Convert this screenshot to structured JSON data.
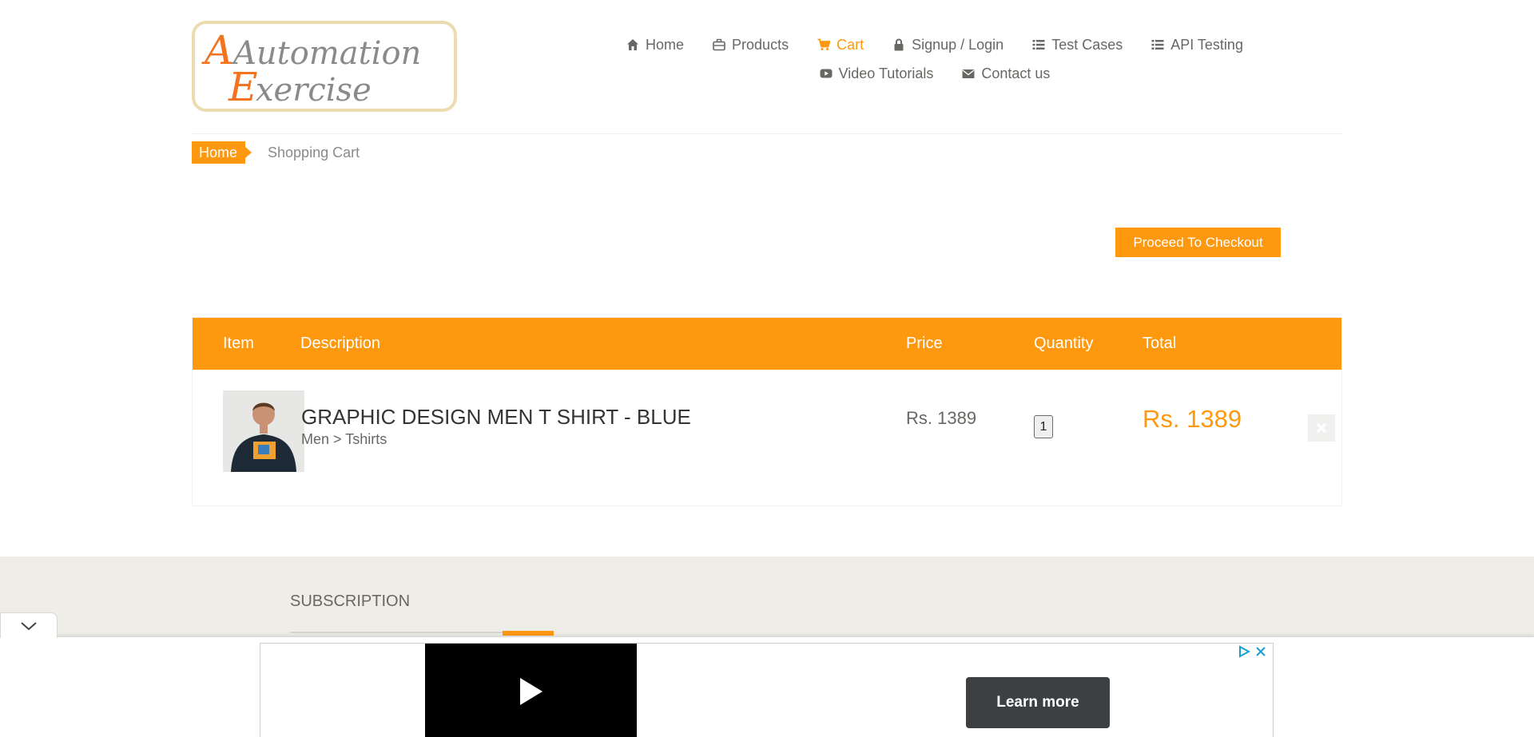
{
  "logo": {
    "line1": "Automation",
    "line2": "Exercise"
  },
  "nav": {
    "row1": [
      {
        "label": "Home",
        "icon": "home-icon"
      },
      {
        "label": "Products",
        "icon": "briefcase-icon"
      },
      {
        "label": "Cart",
        "icon": "cart-icon",
        "active": true
      },
      {
        "label": "Signup / Login",
        "icon": "lock-icon"
      },
      {
        "label": "Test Cases",
        "icon": "list-icon"
      },
      {
        "label": "API Testing",
        "icon": "list-icon"
      }
    ],
    "row2": [
      {
        "label": "Video Tutorials",
        "icon": "youtube-icon"
      },
      {
        "label": "Contact us",
        "icon": "envelope-icon"
      }
    ]
  },
  "breadcrumb": {
    "home": "Home",
    "current": "Shopping Cart"
  },
  "checkout": {
    "label": "Proceed To Checkout"
  },
  "cart": {
    "headers": {
      "item": "Item",
      "description": "Description",
      "price": "Price",
      "quantity": "Quantity",
      "total": "Total"
    },
    "items": [
      {
        "name": "GRAPHIC DESIGN MEN T SHIRT - BLUE",
        "category": "Men > Tshirts",
        "price": "Rs. 1389",
        "quantity": "1",
        "total": "Rs. 1389"
      }
    ]
  },
  "footer": {
    "subscription_title": "SUBSCRIPTION"
  },
  "ad": {
    "learn_more": "Learn more"
  },
  "colors": {
    "accent": "#fe980f",
    "text": "#696763",
    "footer_bg": "#eeede7"
  }
}
